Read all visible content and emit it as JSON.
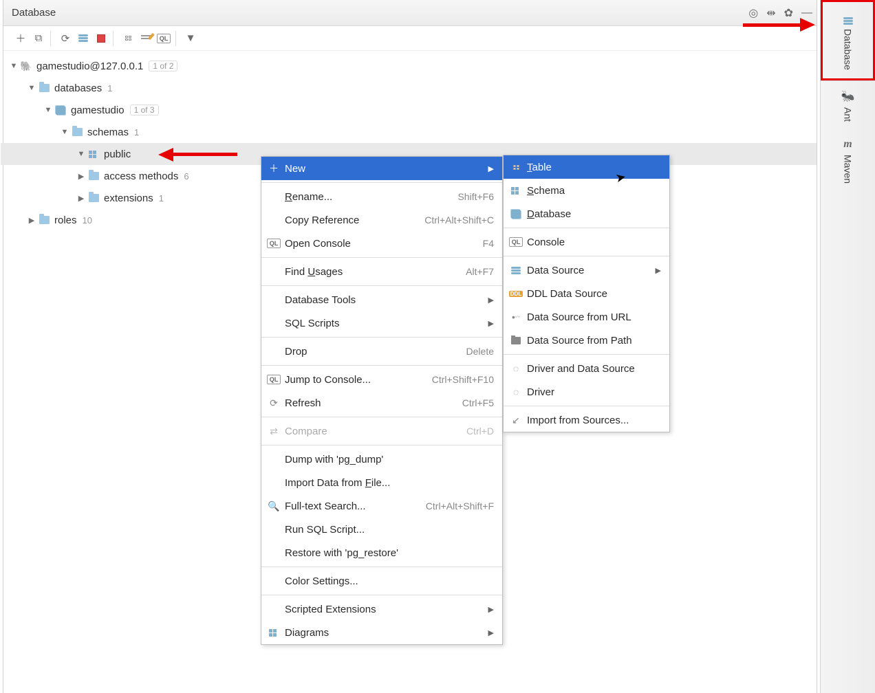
{
  "window": {
    "title": "Database"
  },
  "toolbar": {
    "items": [
      "add",
      "copy",
      "refresh",
      "dbtools",
      "stop",
      "table",
      "edit",
      "console",
      "filter"
    ]
  },
  "tree": {
    "root": {
      "label": "gamestudio@127.0.0.1",
      "badge": "1 of 2"
    },
    "databases": {
      "label": "databases",
      "count": "1"
    },
    "db": {
      "label": "gamestudio",
      "badge": "1 of 3"
    },
    "schemas": {
      "label": "schemas",
      "count": "1"
    },
    "public": {
      "label": "public"
    },
    "access": {
      "label": "access methods",
      "count": "6"
    },
    "extensions": {
      "label": "extensions",
      "count": "1"
    },
    "roles": {
      "label": "roles",
      "count": "10"
    }
  },
  "context_menu": [
    {
      "label": "New",
      "highlighted": true,
      "submenu": true
    },
    {
      "sep": true
    },
    {
      "label_html": "<span class='u'>R</span>ename...",
      "shortcut": "Shift+F6"
    },
    {
      "label": "Copy Reference",
      "shortcut": "Ctrl+Alt+Shift+C"
    },
    {
      "icon": "ql",
      "label": "Open Console",
      "shortcut": "F4"
    },
    {
      "sep": true
    },
    {
      "label_html": "Find <span class='u'>U</span>sages",
      "shortcut": "Alt+F7"
    },
    {
      "sep": true
    },
    {
      "label": "Database Tools",
      "submenu": true
    },
    {
      "label": "SQL Scripts",
      "submenu": true
    },
    {
      "sep": true
    },
    {
      "label": "Drop",
      "shortcut": "Delete"
    },
    {
      "sep": true
    },
    {
      "icon": "ql",
      "label": "Jump to Console...",
      "shortcut": "Ctrl+Shift+F10"
    },
    {
      "icon": "refresh",
      "label": "Refresh",
      "shortcut": "Ctrl+F5"
    },
    {
      "sep": true
    },
    {
      "icon": "compare",
      "label": "Compare",
      "shortcut": "Ctrl+D",
      "disabled": true
    },
    {
      "sep": true
    },
    {
      "label": "Dump with 'pg_dump'"
    },
    {
      "label_html": "Import Data from <span class='u'>F</span>ile..."
    },
    {
      "icon": "search",
      "label": "Full-text Search...",
      "shortcut": "Ctrl+Alt+Shift+F"
    },
    {
      "label": "Run SQL Script..."
    },
    {
      "label": "Restore with 'pg_restore'"
    },
    {
      "sep": true
    },
    {
      "label": "Color Settings..."
    },
    {
      "sep": true
    },
    {
      "label": "Scripted Extensions",
      "submenu": true
    },
    {
      "icon": "diagram",
      "label": "Diagrams",
      "submenu": true
    }
  ],
  "submenu_new": [
    {
      "icon": "table",
      "label_html": "<span class='u'>T</span>able",
      "highlighted": true
    },
    {
      "icon": "schema",
      "label_html": "<span class='u'>S</span>chema"
    },
    {
      "icon": "database",
      "label_html": "<span class='u'>D</span>atabase"
    },
    {
      "sep": true
    },
    {
      "icon": "ql",
      "label": "Console"
    },
    {
      "sep": true
    },
    {
      "icon": "datasource",
      "label": "Data Source",
      "submenu": true
    },
    {
      "icon": "ddl",
      "label": "DDL Data Source"
    },
    {
      "icon": "url",
      "label": "Data Source from URL"
    },
    {
      "icon": "path",
      "label": "Data Source from Path"
    },
    {
      "sep": true
    },
    {
      "icon": "driver",
      "label": "Driver and Data Source"
    },
    {
      "icon": "driver",
      "label": "Driver"
    },
    {
      "sep": true
    },
    {
      "icon": "import",
      "label": "Import from Sources..."
    }
  ],
  "ribbon": [
    {
      "icon": "database",
      "label": "Database",
      "boxed": true
    },
    {
      "icon": "ant",
      "label": "Ant"
    },
    {
      "icon": "maven",
      "label": "Maven"
    }
  ]
}
